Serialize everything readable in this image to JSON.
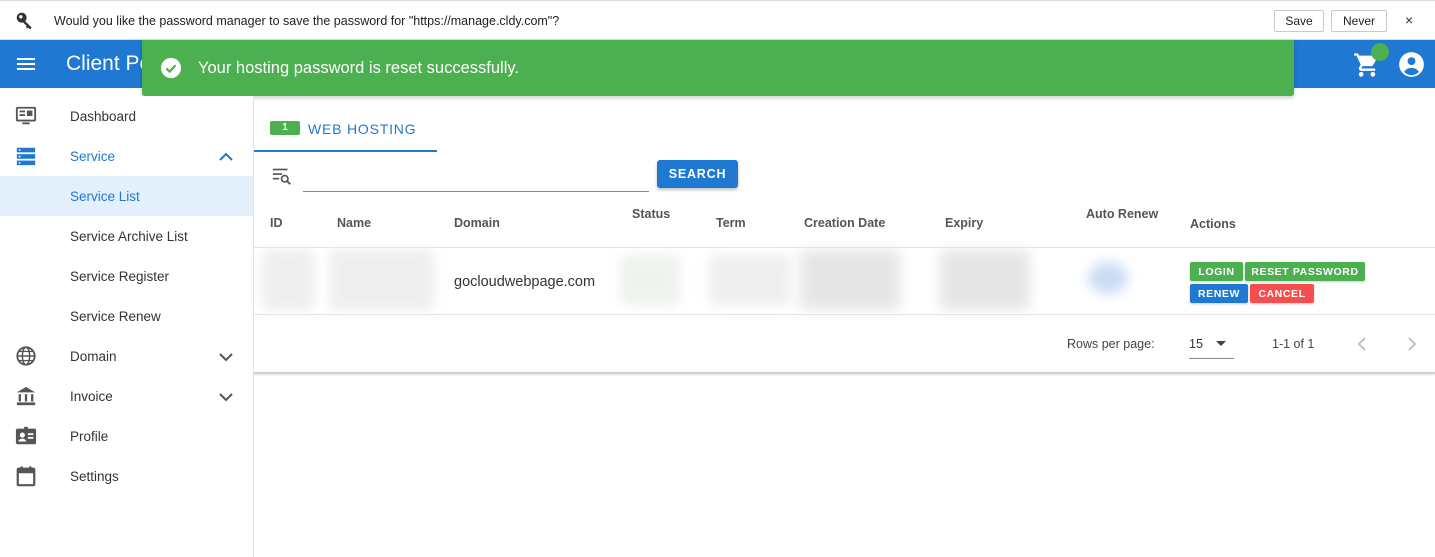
{
  "password_bar": {
    "message": "Would you like the password manager to save the password for \"https://manage.cldy.com\"?",
    "save_label": "Save",
    "never_label": "Never",
    "close_label": "×"
  },
  "appbar": {
    "title": "Client Po",
    "accent_color": "#1f78d1"
  },
  "toast": {
    "message": "Your hosting password is reset successfully.",
    "color": "#4caf50"
  },
  "sidebar": {
    "items": [
      {
        "label": "Dashboard",
        "icon": "monitor-icon"
      },
      {
        "label": "Service",
        "icon": "server-icon",
        "expanded": true
      },
      {
        "label": "Service List",
        "selected": true
      },
      {
        "label": "Service Archive List"
      },
      {
        "label": "Service Register"
      },
      {
        "label": "Service Renew"
      },
      {
        "label": "Domain",
        "icon": "globe-icon"
      },
      {
        "label": "Invoice",
        "icon": "bank-icon"
      },
      {
        "label": "Profile",
        "icon": "profile-card-icon"
      },
      {
        "label": "Settings",
        "icon": "calendar-icon"
      }
    ]
  },
  "tabs": [
    {
      "badge": "1",
      "label": "WEB HOSTING"
    }
  ],
  "search": {
    "value": "",
    "placeholder": "",
    "button_label": "SEARCH"
  },
  "table": {
    "headers": [
      "ID",
      "Name",
      "Domain",
      "Status",
      "Term",
      "Creation Date",
      "Expiry",
      "Auto Renew",
      "Actions"
    ],
    "rows": [
      {
        "domain": "gocloudwebpage.com"
      }
    ],
    "actions": {
      "login": "LOGIN",
      "reset_password": "RESET PASSWORD",
      "renew": "RENEW",
      "cancel": "CANCEL"
    }
  },
  "pagination": {
    "rows_per_page_label": "Rows per page:",
    "rows_per_page": "15",
    "range": "1-1 of 1"
  }
}
